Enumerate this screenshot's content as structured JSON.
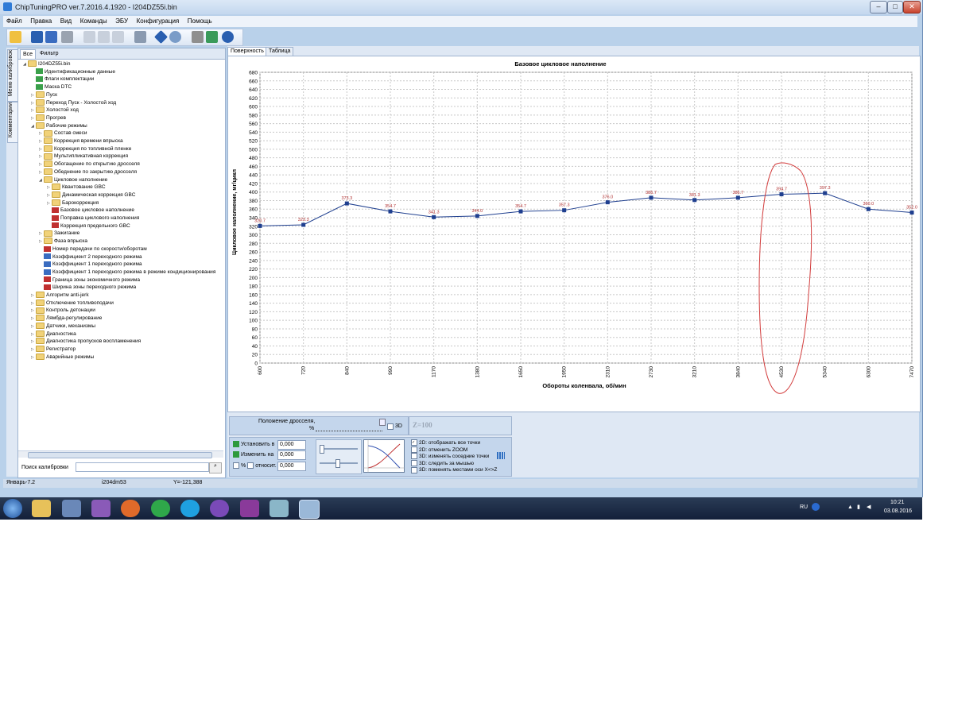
{
  "window": {
    "title": "ChipTuningPRO ver.7.2016.4.1920 - I204DZ55i.bin",
    "min_glyph": "–",
    "max_glyph": "□",
    "close_glyph": "✕"
  },
  "menu": [
    "Файл",
    "Правка",
    "Вид",
    "Команды",
    "ЭБУ",
    "Конфигурация",
    "Помощь"
  ],
  "side_tabs": [
    "Меню калибровок",
    "Комментарии"
  ],
  "filter_tabs": [
    "Все",
    "Фильтр"
  ],
  "tree": [
    {
      "label": "I204DZ55i.bin",
      "level": 0,
      "kind": "folder",
      "expanded": true
    },
    {
      "label": "Идентификационные данные",
      "level": 1,
      "kind": "check"
    },
    {
      "label": "Флаги комплектации",
      "level": 1,
      "kind": "check"
    },
    {
      "label": "Маска DTC",
      "level": 1,
      "kind": "check"
    },
    {
      "label": "Пуск",
      "level": 1,
      "kind": "folder"
    },
    {
      "label": "Переход Пуск - Холостой ход",
      "level": 1,
      "kind": "folder"
    },
    {
      "label": "Холостой ход",
      "level": 1,
      "kind": "folder"
    },
    {
      "label": "Прогрев",
      "level": 1,
      "kind": "folder"
    },
    {
      "label": "Рабочие режимы",
      "level": 1,
      "kind": "folder",
      "expanded": true
    },
    {
      "label": "Состав смеси",
      "level": 2,
      "kind": "folder"
    },
    {
      "label": "Коррекция времени впрыска",
      "level": 2,
      "kind": "folder"
    },
    {
      "label": "Коррекция по топливной пленке",
      "level": 2,
      "kind": "folder"
    },
    {
      "label": "Мультипликативная коррекция",
      "level": 2,
      "kind": "folder"
    },
    {
      "label": "Обогащение по открытию дросселя",
      "level": 2,
      "kind": "folder"
    },
    {
      "label": "Обеднение по закрытию дросселя",
      "level": 2,
      "kind": "folder"
    },
    {
      "label": "Цикловое наполнение",
      "level": 2,
      "kind": "folder",
      "expanded": true
    },
    {
      "label": "Квантование GBC",
      "level": 3,
      "kind": "folder"
    },
    {
      "label": "Динамическая коррекция GBC",
      "level": 3,
      "kind": "folder"
    },
    {
      "label": "Барокоррекция",
      "level": 3,
      "kind": "folder"
    },
    {
      "label": "Базовое цикловое наполнение",
      "level": 3,
      "kind": "chart"
    },
    {
      "label": "Поправка циклового наполнения",
      "level": 3,
      "kind": "chart"
    },
    {
      "label": "Коррекция предельного GBC",
      "level": 3,
      "kind": "chart"
    },
    {
      "label": "Зажигание",
      "level": 2,
      "kind": "folder"
    },
    {
      "label": "Фаза впрыска",
      "level": 2,
      "kind": "folder"
    },
    {
      "label": "Номер передачи по скорости/оборотам",
      "level": 2,
      "kind": "chart"
    },
    {
      "label": "Коэффициент 2 переходного режима",
      "level": 2,
      "kind": "value"
    },
    {
      "label": "Коэффициент 1 переходного режима",
      "level": 2,
      "kind": "value"
    },
    {
      "label": "Коэффициент 1 переходного режима в режиме кондиционирования",
      "level": 2,
      "kind": "value"
    },
    {
      "label": "Граница зоны экономичного режима",
      "level": 2,
      "kind": "chart"
    },
    {
      "label": "Ширина зоны переходного режима",
      "level": 2,
      "kind": "chart"
    },
    {
      "label": "Алгоритм anti-jerk",
      "level": 1,
      "kind": "folder"
    },
    {
      "label": "Отключение топливоподачи",
      "level": 1,
      "kind": "folder"
    },
    {
      "label": "Контроль детонации",
      "level": 1,
      "kind": "folder"
    },
    {
      "label": "Лямбда-регулирование",
      "level": 1,
      "kind": "folder"
    },
    {
      "label": "Датчики, механизмы",
      "level": 1,
      "kind": "folder"
    },
    {
      "label": "Диагностика",
      "level": 1,
      "kind": "folder"
    },
    {
      "label": "Диагностика пропусков воспламенения",
      "level": 1,
      "kind": "folder"
    },
    {
      "label": "Регистратор",
      "level": 1,
      "kind": "folder"
    },
    {
      "label": "Аварийные режимы",
      "level": 1,
      "kind": "folder"
    }
  ],
  "search": {
    "label": "Поиск калибровки",
    "value": ""
  },
  "status": {
    "left": "Январь-7.2",
    "middle": "i204dm53",
    "right": "Y=-121,388"
  },
  "view_tabs": [
    "Поверхность",
    "Таблица"
  ],
  "chart_data": {
    "type": "line",
    "title": "Базовое цикловое наполнение",
    "xlabel": "Обороты коленвала, об/мин",
    "ylabel": "Цикловое наполнение, мг/цикл",
    "ylim": [
      0,
      680
    ],
    "ytick_step": 20,
    "categories": [
      "600",
      "720",
      "840",
      "990",
      "1170",
      "1380",
      "1650",
      "1950",
      "2310",
      "2730",
      "3210",
      "3840",
      "4530",
      "5340",
      "6300",
      "7470"
    ],
    "series": [
      {
        "values": [
          320.7,
          323.3,
          373.3,
          354.7,
          341.3,
          344.0,
          354.7,
          357.3,
          376.0,
          386.7,
          381.3,
          386.7,
          394.7,
          397.3,
          360.0,
          352.0
        ]
      }
    ],
    "data_labels": [
      "320.7",
      "323.3",
      "373.3",
      "354.7",
      "341.3",
      "344.0",
      "354.7",
      "357.3",
      "376.0",
      "386.7",
      "381.3",
      "386.7",
      "394.7",
      "397.3",
      "360.0",
      "352.0"
    ],
    "line_color": "#1f3f8f",
    "label_color": "#b03030",
    "annotation": "red hand-drawn ellipse around x=4530 point"
  },
  "controls": {
    "throttle_label": "Положение дросселя,",
    "throttle_unit": "%",
    "throttle_3d": "3D",
    "z_label": "Z=100",
    "set_label": "Установить в",
    "set_value": "0,000",
    "change_label": "Изменить на",
    "change_value": "0,000",
    "pct_label": "%",
    "rel_label": "относит.",
    "rel_value": "0,000",
    "options": [
      {
        "label": "2D: отображать все точки",
        "checked": true
      },
      {
        "label": "2D: отменить ZOOM",
        "checked": false
      },
      {
        "label": "3D: изменять соседние точки",
        "checked": false
      },
      {
        "label": "3D: следить за мышью",
        "checked": false
      },
      {
        "label": "3D: поменять местами оси X<>Z",
        "checked": false
      }
    ]
  },
  "taskbar": {
    "lang": "RU",
    "time": "10:21",
    "date": "03.08.2016"
  }
}
